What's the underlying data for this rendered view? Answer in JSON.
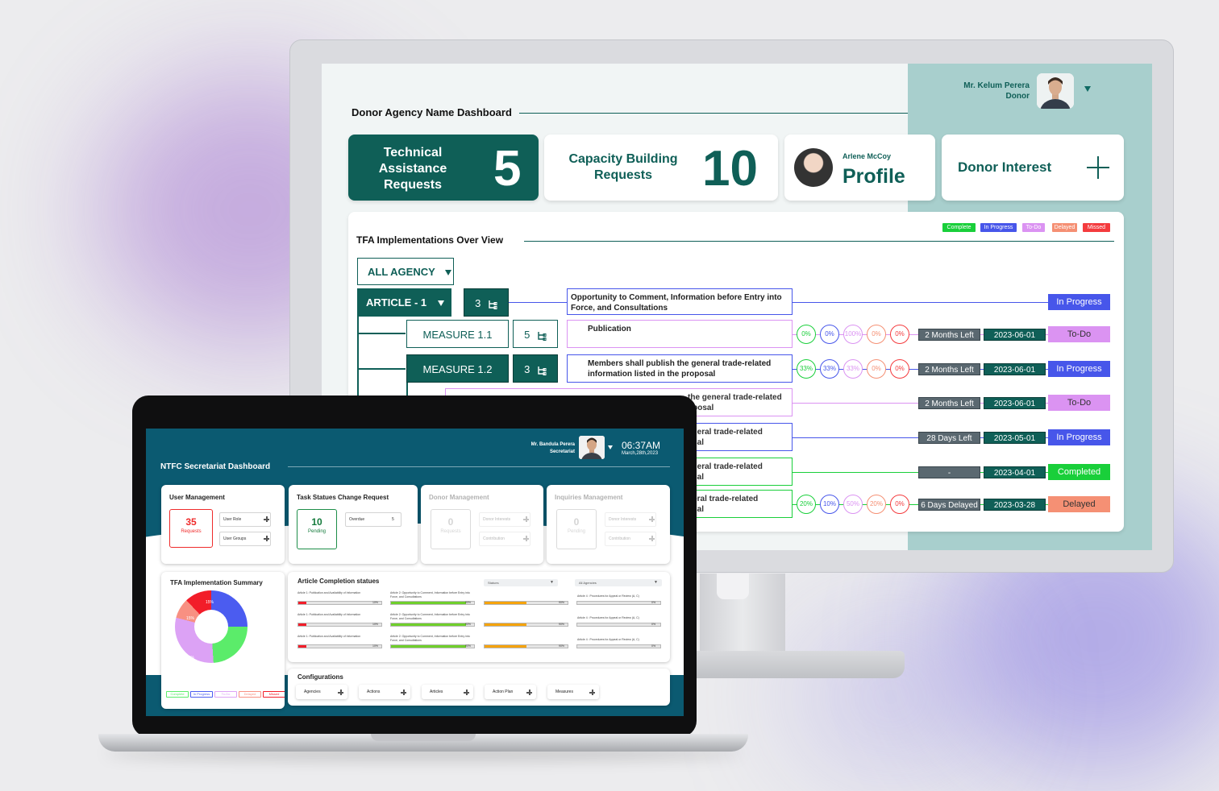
{
  "monitor": {
    "user": {
      "name": "Mr. Kelum Perera",
      "role": "Donor"
    },
    "dashboard_title": "Donor Agency Name  Dashboard",
    "cards": {
      "technical": {
        "label": "Technical Assistance Requests",
        "count": "5"
      },
      "capacity": {
        "label": "Capacity Building Requests",
        "count": "10"
      },
      "profile": {
        "name": "Arlene McCoy",
        "label": "Profile"
      },
      "donor": {
        "label": "Donor Interest"
      }
    },
    "panel": {
      "title": "TFA Implementations Over View",
      "legend": [
        {
          "label": "Complete",
          "color": "#19cf3a"
        },
        {
          "label": "In Progress",
          "color": "#4756ea"
        },
        {
          "label": "To-Do",
          "color": "#db93f2"
        },
        {
          "label": "Delayed",
          "color": "#f59074"
        },
        {
          "label": "Missed",
          "color": "#f43b3e"
        }
      ],
      "agency_select": "ALL AGENCY",
      "article": {
        "label": "ARTICLE - 1",
        "count": "3"
      },
      "measures": [
        {
          "label": "MEASURE 1.1",
          "count": "5"
        },
        {
          "label": "MEASURE 1.2",
          "count": "3"
        }
      ],
      "rows": [
        {
          "topic": "Opportunity to Comment, Information before Entry into Force, and Consultations",
          "line_color": "#4756ea",
          "status": "In Progress",
          "status_color": "#4756ea",
          "status_text_color": "#ffffff"
        },
        {
          "topic": "Publication",
          "line_color": "#db93f2",
          "circles": [
            "0%",
            "0%",
            "100%",
            "0%",
            "0%"
          ],
          "deadline": "2 Months Left",
          "date": "2023-06-01",
          "status": "To-Do",
          "status_color": "#db93f2",
          "status_text_color": "#333333"
        },
        {
          "topic": "Members shall publish the general trade-related information listed in the proposal",
          "line_color": "#4756ea",
          "circles": [
            "33%",
            "33%",
            "33%",
            "0%",
            "0%"
          ],
          "deadline": "2 Months Left",
          "date": "2023-06-01",
          "status": "In Progress",
          "status_color": "#4756ea",
          "status_text_color": "#ffffff"
        },
        {
          "topic": "the general trade-related",
          "topic2": "oposal",
          "line_color": "#db93f2",
          "deadline": "2 Months Left",
          "date": "2023-06-01",
          "status": "To-Do",
          "status_color": "#db93f2",
          "status_text_color": "#333333"
        },
        {
          "topic": "eneral trade-related",
          "topic2": "osal",
          "line_color": "#4756ea",
          "deadline": "28 Days Left",
          "date": "2023-05-01",
          "status": "In Progress",
          "status_color": "#4756ea",
          "status_text_color": "#ffffff"
        },
        {
          "topic": "eneral trade-related",
          "topic2": "osal",
          "line_color": "#19cf3a",
          "deadline": "-",
          "date": "2023-04-01",
          "status": "Completed",
          "status_color": "#19cf3a",
          "status_text_color": "#ffffff"
        },
        {
          "topic": "neral trade-related",
          "topic2": "osal",
          "line_color": "#19cf3a",
          "circles": [
            "20%",
            "10%",
            "50%",
            "20%",
            "0%"
          ],
          "deadline": "6 Days Delayed",
          "date": "2023-03-28",
          "status": "Delayed",
          "status_color": "#f59074",
          "status_text_color": "#333333"
        }
      ]
    }
  },
  "laptop": {
    "user": {
      "name": "Mr. Bandula Perera",
      "role": "Secretariat"
    },
    "time": "06:37AM",
    "date": "March,28th,2023",
    "dashboard_title": "NTFC Secretariat Dashboard",
    "cards": {
      "user_mgmt": {
        "title": "User Management",
        "count": "35",
        "sub": "Requests",
        "btn1": "User Role",
        "btn2": "User Groups"
      },
      "task": {
        "title": "Task Statues Change Request",
        "count": "10",
        "sub": "Pending",
        "overdue_label": "Overdue",
        "overdue_count": "5"
      },
      "donor_mgmt": {
        "title": "Donor Management",
        "count": "0",
        "sub": "Requests",
        "btn1": "Donor Interests",
        "btn2": "Contribution"
      },
      "inquiries": {
        "title": "Inquiries Management",
        "count": "0",
        "sub": "Pending",
        "btn1": "Donor Interests",
        "btn2": "Contribution"
      }
    },
    "summary": {
      "title": "TFA Implementation Summary",
      "legend": [
        "Complete",
        "In Progress",
        "To-Do",
        "Delayed",
        "Missed"
      ]
    },
    "articles": {
      "title": "Article Completion statues",
      "status_filter": "Statues",
      "agency_filter": "All Agencies",
      "rows": [
        {
          "a": "Article 1: Publication and Availability of Information",
          "p1": "10%",
          "b": "Article 2: Opportunity to Comment, Information before Entry into Force, and Consultations",
          "p2": "90%",
          "p3": "90%",
          "c": "Article 4 : Procedures for Appeal or Review (A, C)",
          "p4": "0%"
        },
        {
          "a": "Article 1: Publication and Availability of Information",
          "p1": "10%",
          "b": "Article 2: Opportunity to Comment, Information before Entry into Force, and Consultations",
          "p2": "90%",
          "p3": "90%",
          "c": "Article 4 : Procedures for Appeal or Review (A, C)",
          "p4": "0%"
        },
        {
          "a": "Article 1: Publication and Availability of Information",
          "p1": "10%",
          "b": "Article 2: Opportunity to Comment, Information before Entry into Force, and Consultations",
          "p2": "90%",
          "p3": "90%",
          "c": "Article 4 : Procedures for Appeal or Review (A, C)",
          "p4": "0%"
        }
      ]
    },
    "config": {
      "title": "Configurations",
      "buttons": [
        "Agencies",
        "Actions",
        "Articles",
        "Action Plan",
        "Measures"
      ]
    }
  },
  "chart_data": {
    "type": "pie",
    "title": "TFA Implementation Summary",
    "categories": [
      "In Progress",
      "Complete",
      "To-Do",
      "Delayed",
      "Missed"
    ],
    "values": [
      45,
      45,
      30,
      15,
      15
    ],
    "labels": [
      "45%",
      "45%",
      "30%",
      "15%",
      "15%"
    ],
    "colors": [
      "#4b5cf0",
      "#5bec6a",
      "#dca2f5",
      "#f89082",
      "#f21d29"
    ],
    "legend": "bottom"
  }
}
